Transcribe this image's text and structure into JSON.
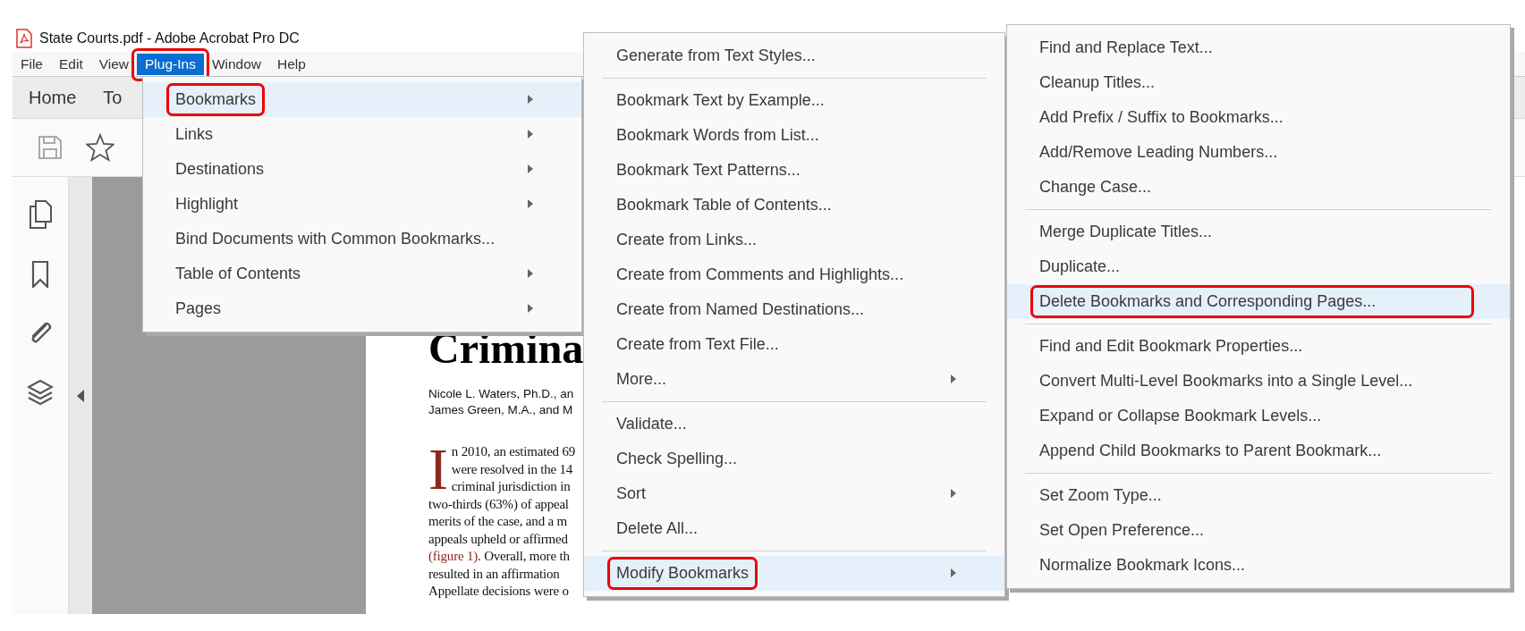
{
  "window": {
    "title": "State Courts.pdf - Adobe Acrobat Pro DC"
  },
  "menubar": [
    {
      "label": "File",
      "selected": false,
      "annotated": false
    },
    {
      "label": "Edit",
      "selected": false,
      "annotated": false
    },
    {
      "label": "View",
      "selected": false,
      "annotated": false
    },
    {
      "label": "Plug-Ins",
      "selected": true,
      "annotated": true
    },
    {
      "label": "Window",
      "selected": false,
      "annotated": false
    },
    {
      "label": "Help",
      "selected": false,
      "annotated": false
    }
  ],
  "tabs": [
    {
      "label": "Home"
    },
    {
      "label": "To"
    }
  ],
  "document": {
    "title": "Crimina",
    "authors": [
      "Nicole L. Waters, Ph.D., an",
      "James Green, M.A., and M"
    ],
    "drop_cap": "I",
    "lines": [
      {
        "text": "n 2010, an estimated 69"
      },
      {
        "text": "were resolved in the 14"
      },
      {
        "text": "criminal jurisdiction in"
      },
      {
        "text": "two-thirds (63%) of appeal"
      },
      {
        "text": "merits of the case, and a m"
      },
      {
        "text": "appeals upheld or affirmed"
      },
      {
        "link": "(figure 1)",
        "text": ". Overall, more th"
      },
      {
        "text": "resulted in an affirmation"
      },
      {
        "text": "Appellate decisions were o"
      }
    ]
  },
  "menus": [
    {
      "items": [
        {
          "kind": "item",
          "label": "Bookmarks",
          "selected": true,
          "submenu": true,
          "annotated": true
        },
        {
          "kind": "item",
          "label": "Links",
          "selected": false,
          "submenu": true,
          "annotated": false
        },
        {
          "kind": "item",
          "label": "Destinations",
          "selected": false,
          "submenu": true,
          "annotated": false
        },
        {
          "kind": "item",
          "label": "Highlight",
          "selected": false,
          "submenu": true,
          "annotated": false
        },
        {
          "kind": "item",
          "label": "Bind Documents with Common Bookmarks...",
          "selected": false,
          "submenu": false,
          "annotated": false
        },
        {
          "kind": "item",
          "label": "Table of Contents",
          "selected": false,
          "submenu": true,
          "annotated": false
        },
        {
          "kind": "item",
          "label": "Pages",
          "selected": false,
          "submenu": true,
          "annotated": false
        }
      ]
    },
    {
      "items": [
        {
          "kind": "item",
          "label": "Generate from Text Styles...",
          "selected": false,
          "submenu": false,
          "annotated": false
        },
        {
          "kind": "separator"
        },
        {
          "kind": "item",
          "label": "Bookmark Text by Example...",
          "selected": false,
          "submenu": false,
          "annotated": false
        },
        {
          "kind": "item",
          "label": "Bookmark Words from List...",
          "selected": false,
          "submenu": false,
          "annotated": false
        },
        {
          "kind": "item",
          "label": "Bookmark Text Patterns...",
          "selected": false,
          "submenu": false,
          "annotated": false
        },
        {
          "kind": "item",
          "label": "Bookmark Table of Contents...",
          "selected": false,
          "submenu": false,
          "annotated": false
        },
        {
          "kind": "item",
          "label": "Create from Links...",
          "selected": false,
          "submenu": false,
          "annotated": false
        },
        {
          "kind": "item",
          "label": "Create from Comments and Highlights...",
          "selected": false,
          "submenu": false,
          "annotated": false
        },
        {
          "kind": "item",
          "label": "Create from Named Destinations...",
          "selected": false,
          "submenu": false,
          "annotated": false
        },
        {
          "kind": "item",
          "label": "Create from Text File...",
          "selected": false,
          "submenu": false,
          "annotated": false
        },
        {
          "kind": "item",
          "label": "More...",
          "selected": false,
          "submenu": true,
          "annotated": false
        },
        {
          "kind": "separator"
        },
        {
          "kind": "item",
          "label": "Validate...",
          "selected": false,
          "submenu": false,
          "annotated": false
        },
        {
          "kind": "item",
          "label": "Check Spelling...",
          "selected": false,
          "submenu": false,
          "annotated": false
        },
        {
          "kind": "item",
          "label": "Sort",
          "selected": false,
          "submenu": true,
          "annotated": false
        },
        {
          "kind": "item",
          "label": "Delete All...",
          "selected": false,
          "submenu": false,
          "annotated": false
        },
        {
          "kind": "separator"
        },
        {
          "kind": "item",
          "label": "Modify Bookmarks",
          "selected": true,
          "submenu": true,
          "annotated": true
        }
      ]
    },
    {
      "items": [
        {
          "kind": "item",
          "label": "Find and Replace Text...",
          "selected": false,
          "submenu": false,
          "annotated": false
        },
        {
          "kind": "item",
          "label": "Cleanup Titles...",
          "selected": false,
          "submenu": false,
          "annotated": false
        },
        {
          "kind": "item",
          "label": "Add Prefix / Suffix to Bookmarks...",
          "selected": false,
          "submenu": false,
          "annotated": false
        },
        {
          "kind": "item",
          "label": "Add/Remove Leading Numbers...",
          "selected": false,
          "submenu": false,
          "annotated": false
        },
        {
          "kind": "item",
          "label": "Change Case...",
          "selected": false,
          "submenu": false,
          "annotated": false
        },
        {
          "kind": "separator"
        },
        {
          "kind": "item",
          "label": "Merge Duplicate Titles...",
          "selected": false,
          "submenu": false,
          "annotated": false
        },
        {
          "kind": "item",
          "label": "Duplicate...",
          "selected": false,
          "submenu": false,
          "annotated": false
        },
        {
          "kind": "item",
          "label": "Delete Bookmarks and Corresponding Pages...",
          "selected": true,
          "submenu": false,
          "annotated": true
        },
        {
          "kind": "separator"
        },
        {
          "kind": "item",
          "label": "Find and Edit Bookmark Properties...",
          "selected": false,
          "submenu": false,
          "annotated": false
        },
        {
          "kind": "item",
          "label": "Convert Multi-Level Bookmarks into a Single Level...",
          "selected": false,
          "submenu": false,
          "annotated": false
        },
        {
          "kind": "item",
          "label": "Expand or Collapse Bookmark Levels...",
          "selected": false,
          "submenu": false,
          "annotated": false
        },
        {
          "kind": "item",
          "label": "Append Child Bookmarks to Parent Bookmark...",
          "selected": false,
          "submenu": false,
          "annotated": false
        },
        {
          "kind": "separator"
        },
        {
          "kind": "item",
          "label": "Set Zoom Type...",
          "selected": false,
          "submenu": false,
          "annotated": false
        },
        {
          "kind": "item",
          "label": "Set Open Preference...",
          "selected": false,
          "submenu": false,
          "annotated": false
        },
        {
          "kind": "item",
          "label": "Normalize Bookmark Icons...",
          "selected": false,
          "submenu": false,
          "annotated": false
        }
      ]
    }
  ]
}
